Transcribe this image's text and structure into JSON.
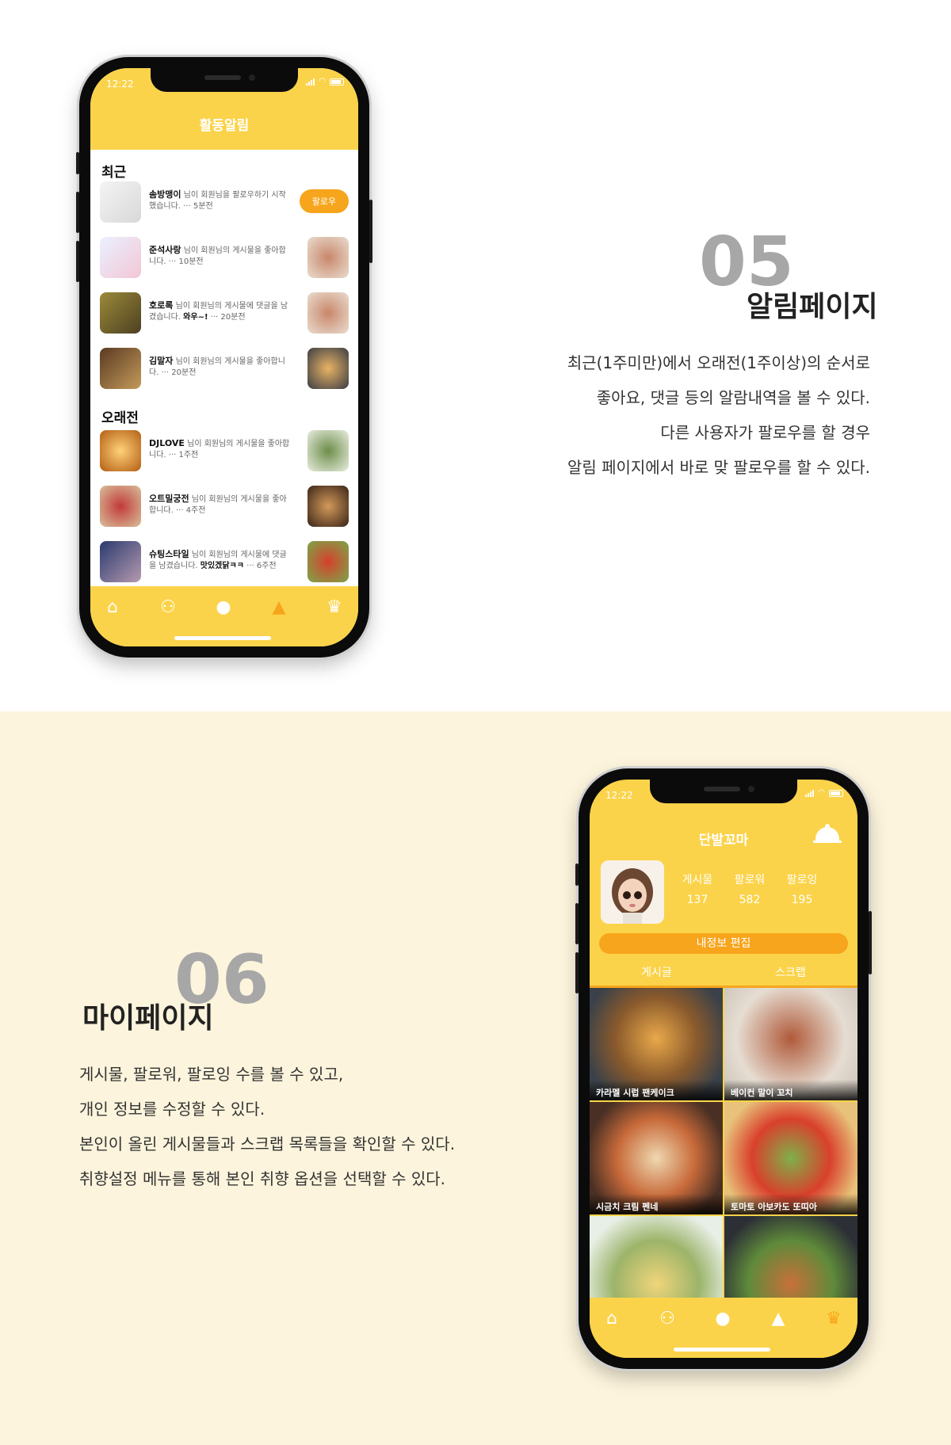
{
  "section05": {
    "number": "05",
    "heading": "알림페이지",
    "lines": [
      "최근(1주미만)에서 오래전(1주이상)의 순서로",
      "좋아요, 댓글 등의 알람내역을 볼 수 있다.",
      "다른 사용자가 팔로우를 할 경우",
      "알림 페이지에서 바로 맞 팔로우를 할 수 있다."
    ]
  },
  "section06": {
    "number": "06",
    "heading": "마이페이지",
    "lines": [
      "게시물, 팔로워, 팔로잉 수를 볼 수 있고,",
      "개인 정보를 수정할 수 있다.",
      "본인이 올린 게시물들과 스크랩 목록들을 확인할 수 있다.",
      "취향설정 메뉴를 통해 본인 취향 옵션을 선택할 수 있다."
    ]
  },
  "phone1": {
    "time": "12:22",
    "title": "활동알림",
    "recent_label": "최근",
    "older_label": "오래전",
    "follow_label": "팔로우",
    "notifications": [
      {
        "user": "솜방맹이",
        "text": "님이 회원님을 팔로우하기 시작했습니다.",
        "extra": "",
        "time": "··· 5분전"
      },
      {
        "user": "준석사랑",
        "text": "님이 회원님의 게시물을 좋아합니다.",
        "extra": "",
        "time": "··· 10분전"
      },
      {
        "user": "호로록",
        "text": "님이 회원님의 게시물에 댓글을 남겼습니다.",
        "extra": "와우~!",
        "time": "··· 20분전"
      },
      {
        "user": "김말자",
        "text": "님이 회원님의 게시물을 좋아합니다.",
        "extra": "",
        "time": "··· 20분전"
      },
      {
        "user": "DJLOVE",
        "text": "님이 회원님의 게시물을 좋아합니다.",
        "extra": "",
        "time": "··· 1주전"
      },
      {
        "user": "오트밀궁전",
        "text": "님이 회원님의 게시물을 좋아합니다.",
        "extra": "",
        "time": "··· 4주전"
      },
      {
        "user": "슈팅스타일",
        "text": "님이 회원님의 게시물에 댓글을 남겼습니다.",
        "extra": "맛있겠닭ㅋㅋ",
        "time": "··· 6주전"
      }
    ]
  },
  "phone2": {
    "time": "12:22",
    "title": "단발꼬마",
    "stats": [
      {
        "label": "게시물",
        "value": "137"
      },
      {
        "label": "팔로워",
        "value": "582"
      },
      {
        "label": "팔로잉",
        "value": "195"
      }
    ],
    "edit_label": "내정보 편집",
    "tab_posts": "게시글",
    "tab_scrap": "스크랩",
    "posts": [
      "카라멜 시럽 팬케이크",
      "베이컨 말이 꼬치",
      "시금치 크림 펜네",
      "토마토 아보카도 또띠아"
    ]
  },
  "colors": {
    "yellow": "#fbd34a",
    "orange": "#f7a51c",
    "cream": "#fcf4dc"
  }
}
